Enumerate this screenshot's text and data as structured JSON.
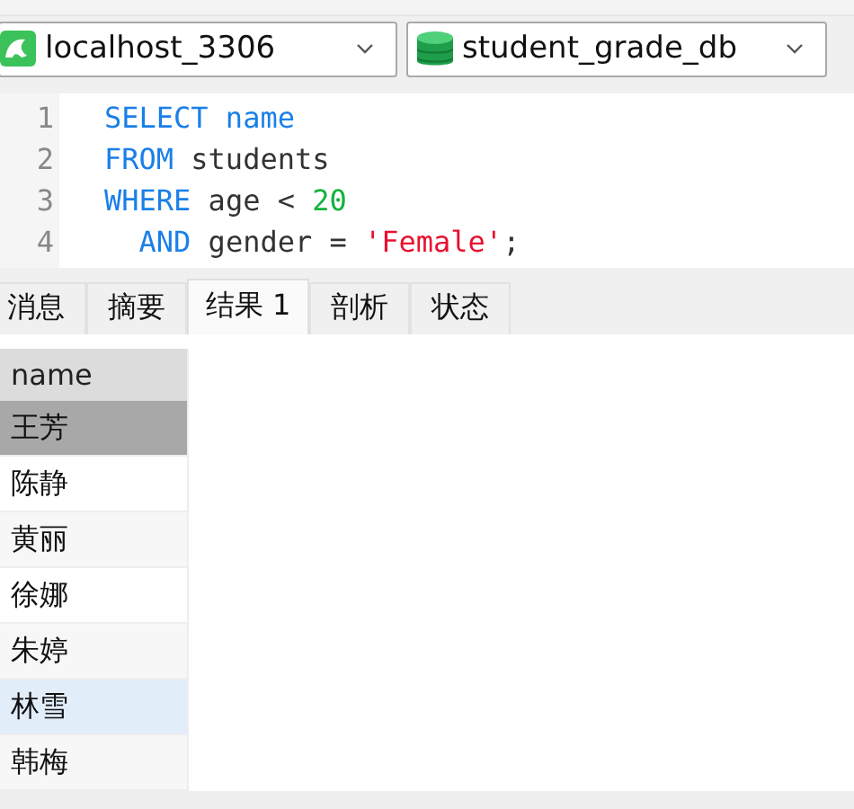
{
  "toolbar": {
    "connection": {
      "value": "localhost_3306"
    },
    "database": {
      "value": "student_grade_db"
    }
  },
  "editor": {
    "lines": [
      {
        "number": "1",
        "tokens": [
          {
            "kind": "keyword",
            "text": "SELECT name"
          }
        ]
      },
      {
        "number": "2",
        "tokens": [
          {
            "kind": "keyword",
            "text": "FROM"
          },
          {
            "kind": "plain",
            "text": " students"
          }
        ]
      },
      {
        "number": "3",
        "tokens": [
          {
            "kind": "keyword",
            "text": "WHERE"
          },
          {
            "kind": "plain",
            "text": " age < "
          },
          {
            "kind": "number",
            "text": "20"
          }
        ]
      },
      {
        "number": "4",
        "tokens": [
          {
            "kind": "keyword",
            "text": "  AND"
          },
          {
            "kind": "plain",
            "text": " gender = "
          },
          {
            "kind": "string",
            "text": "'Female'"
          },
          {
            "kind": "plain",
            "text": ";"
          }
        ]
      }
    ]
  },
  "tabs": [
    {
      "label": "消息",
      "selected": false
    },
    {
      "label": "摘要",
      "selected": false
    },
    {
      "label": "结果 1",
      "selected": true
    },
    {
      "label": "剖析",
      "selected": false
    },
    {
      "label": "状态",
      "selected": false
    }
  ],
  "table": {
    "columns": [
      "name"
    ],
    "rows": [
      {
        "cells": [
          "王芳"
        ],
        "selected": true,
        "hovered": false
      },
      {
        "cells": [
          "陈静"
        ],
        "selected": false,
        "hovered": false
      },
      {
        "cells": [
          "黄丽"
        ],
        "selected": false,
        "hovered": false
      },
      {
        "cells": [
          "徐娜"
        ],
        "selected": false,
        "hovered": false
      },
      {
        "cells": [
          "朱婷"
        ],
        "selected": false,
        "hovered": false
      },
      {
        "cells": [
          "林雪"
        ],
        "selected": false,
        "hovered": true
      },
      {
        "cells": [
          "韩梅"
        ],
        "selected": false,
        "hovered": false
      }
    ]
  }
}
